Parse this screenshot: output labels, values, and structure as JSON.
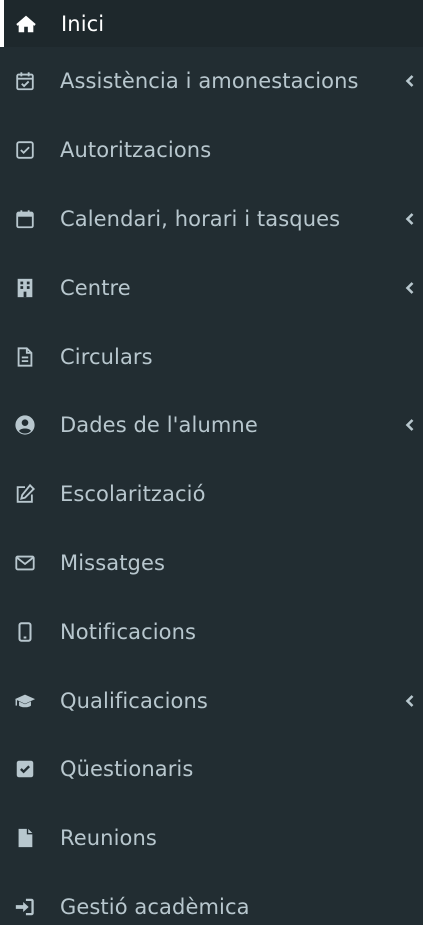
{
  "menu": {
    "items": [
      {
        "label": "Inici",
        "icon": "home-icon"
      },
      {
        "label": "Assistència i amonestacions",
        "icon": "calendar-check-icon"
      },
      {
        "label": "Autoritzacions",
        "icon": "checkbox-icon"
      },
      {
        "label": "Calendari, horari i tasques",
        "icon": "calendar-icon"
      },
      {
        "label": "Centre",
        "icon": "building-icon"
      },
      {
        "label": "Circulars",
        "icon": "file-text-icon"
      },
      {
        "label": "Dades de l'alumne",
        "icon": "user-circle-icon"
      },
      {
        "label": "Escolarització",
        "icon": "edit-icon"
      },
      {
        "label": "Missatges",
        "icon": "envelope-icon"
      },
      {
        "label": "Notificacions",
        "icon": "mobile-icon"
      },
      {
        "label": "Qualificacions",
        "icon": "graduation-cap-icon"
      },
      {
        "label": "Qüestionaris",
        "icon": "check-square-icon"
      },
      {
        "label": "Reunions",
        "icon": "file-icon"
      },
      {
        "label": "Gestió acadèmica",
        "icon": "sign-in-icon"
      }
    ]
  },
  "colors": {
    "sidebar_bg": "#222d32",
    "active_bg": "#1e282c",
    "text": "#b8c7ce",
    "active_text": "#ffffff"
  }
}
